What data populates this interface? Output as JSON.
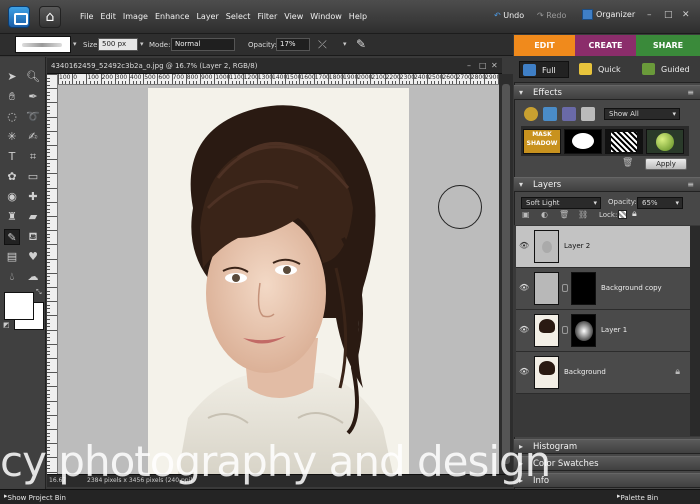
{
  "menubar": {
    "menus": [
      "File",
      "Edit",
      "Image",
      "Enhance",
      "Layer",
      "Select",
      "Filter",
      "View",
      "Window",
      "Help"
    ],
    "undo": "Undo",
    "redo": "Redo",
    "organizer": "Organizer",
    "window_controls": [
      "–",
      "□",
      "✕"
    ]
  },
  "options": {
    "size_label": "Size:",
    "size_value": "500 px",
    "mode_label": "Mode:",
    "mode_value": "Normal",
    "opacity_label": "Opacity:",
    "opacity_value": "17%"
  },
  "mode_tabs": [
    {
      "label": "EDIT",
      "color": "#f08a1c"
    },
    {
      "label": "CREATE",
      "color": "#8b2d6b"
    },
    {
      "label": "SHARE",
      "color": "#3a8a3a"
    }
  ],
  "document": {
    "title": "4340162459_52492c3b2a_o.jpg @ 16.7% (Layer 2, RGB/8)",
    "zoom": "16.67",
    "status": "2384 pixels x 3456 pixels (240 ppi)",
    "controls": [
      "–",
      "□",
      "✕"
    ],
    "ruler_labels": [
      "100",
      "0",
      "100",
      "200",
      "300",
      "400",
      "500",
      "600",
      "700",
      "800",
      "900",
      "1000",
      "1100",
      "1200",
      "1300",
      "1400",
      "1500",
      "1600",
      "1700",
      "1800",
      "1900",
      "2000",
      "2100",
      "2200",
      "2300",
      "2400",
      "2500",
      "2600",
      "2700",
      "2800",
      "2900"
    ]
  },
  "views": [
    "Full",
    "Quick",
    "Guided"
  ],
  "effects": {
    "title": "Effects",
    "filter_select": "Show All",
    "apply_label": "Apply",
    "thumb_label": "MASK SHADOW"
  },
  "layers": {
    "title": "Layers",
    "blend_mode": "Soft Light",
    "opacity_label": "Opacity:",
    "opacity_value": "65%",
    "lock_label": "Lock:",
    "rows": [
      {
        "name": "Layer 2",
        "selected": true
      },
      {
        "name": "Background copy",
        "selected": false
      },
      {
        "name": "Layer 1",
        "selected": false
      },
      {
        "name": "Background",
        "selected": false
      }
    ]
  },
  "collapsed_panels": [
    "Histogram",
    "Color Swatches",
    "Info"
  ],
  "bottom_bar": {
    "left": "Show Project Bin",
    "right": "Palette Bin"
  },
  "watermark": "cy photography and design",
  "colors": {
    "edit_tab": "#f08a1c",
    "create_tab": "#8b2d6b",
    "share_tab": "#3a8a3a",
    "selected_layer": "#c3c3c3"
  }
}
